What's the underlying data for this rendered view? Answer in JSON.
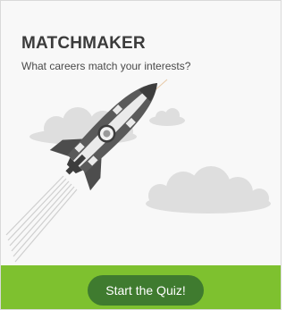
{
  "card": {
    "title": "MATCHMAKER",
    "subtitle": "What careers match your interests?",
    "cta_label": "Start the Quiz!"
  },
  "colors": {
    "footer_bg": "#7ec12f",
    "button_bg": "#3f7b2f",
    "rocket_body": "#5a5a5a",
    "cloud": "#dedede"
  },
  "icons": {
    "illustration": "rocket-icon"
  }
}
